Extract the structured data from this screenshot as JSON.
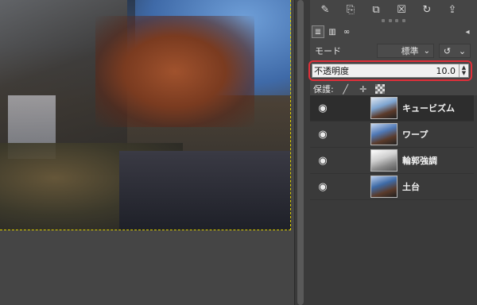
{
  "toolbar_icons": [
    "edit-icon",
    "new-layer-icon",
    "duplicate-icon",
    "delete-icon",
    "refresh-icon",
    "export-icon"
  ],
  "tabs": [
    {
      "name": "layers-tab",
      "icon": "≣"
    },
    {
      "name": "channels-tab",
      "icon": "▥"
    },
    {
      "name": "paths-tab",
      "icon": "∞"
    }
  ],
  "mode": {
    "label": "モード",
    "value": "標準"
  },
  "opacity": {
    "label": "不透明度",
    "value": "10.0"
  },
  "lock": {
    "label": "保護:"
  },
  "layers": [
    {
      "name": "キュービズム",
      "visible": true,
      "selected": true
    },
    {
      "name": "ワープ",
      "visible": true,
      "selected": false
    },
    {
      "name": "輪郭強調",
      "visible": true,
      "selected": false
    },
    {
      "name": "土台",
      "visible": true,
      "selected": false
    }
  ],
  "colors": {
    "highlight": "#e0303a",
    "canvas_border": "#e0d000"
  }
}
